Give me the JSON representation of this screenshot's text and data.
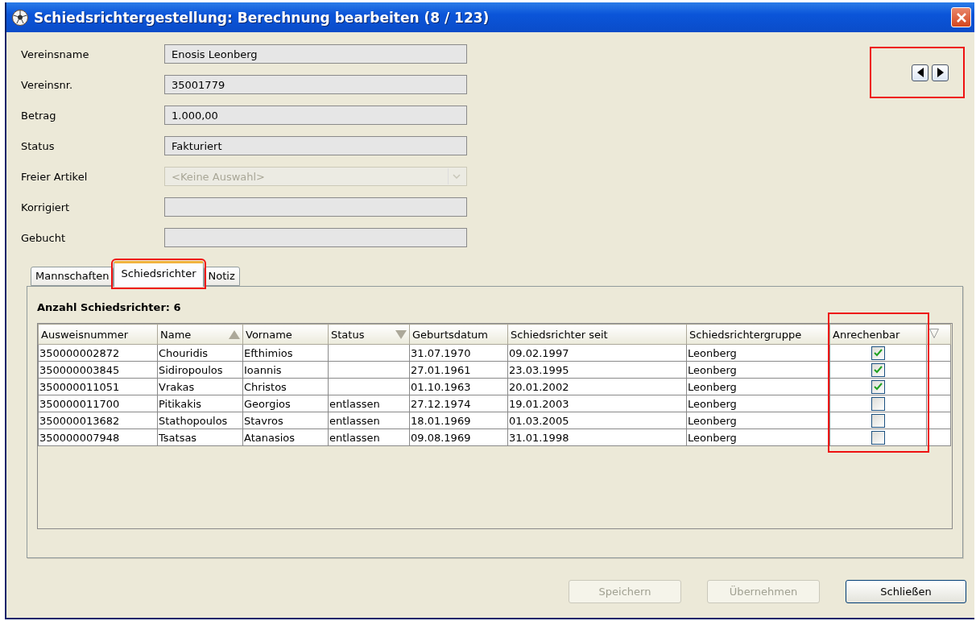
{
  "window": {
    "title": "Schiedsrichtergestellung: Berechnung bearbeiten (8 / 123)"
  },
  "nav": {
    "highlighted": true
  },
  "fields": [
    {
      "label": "Vereinsname",
      "kind": "text",
      "value": "Enosis Leonberg"
    },
    {
      "label": "Vereinsnr.",
      "kind": "text",
      "value": "35001779"
    },
    {
      "label": "Betrag",
      "kind": "text",
      "value": "1.000,00"
    },
    {
      "label": "Status",
      "kind": "text",
      "value": "Fakturiert"
    },
    {
      "label": "Freier Artikel",
      "kind": "select",
      "placeholder": "<Keine Auswahl>",
      "disabled": true
    },
    {
      "label": "Korrigiert",
      "kind": "text"
    },
    {
      "label": "Gebucht",
      "kind": "text"
    }
  ],
  "tabs": [
    {
      "label": "Mannschaften",
      "selected": false,
      "highlighted": false
    },
    {
      "label": "Schiedsrichter",
      "selected": true,
      "highlighted": true
    },
    {
      "label": "Notiz",
      "selected": false,
      "highlighted": false
    }
  ],
  "count_label": "Anzahl Schiedsrichter: 6",
  "table": {
    "columns": [
      {
        "label": "Ausweisnummer",
        "sorted": false,
        "highlighted": false
      },
      {
        "label": "Name",
        "sorted": true,
        "ascending": true,
        "highlighted": false
      },
      {
        "label": "Vorname",
        "sorted": false,
        "highlighted": false
      },
      {
        "label": "Status",
        "sorted": true,
        "ascending": false,
        "highlighted": false
      },
      {
        "label": "Geburtsdatum",
        "sorted": false,
        "highlighted": false
      },
      {
        "label": "Schiedsrichter seit",
        "sorted": false,
        "highlighted": false
      },
      {
        "label": "Schiedsrichtergruppe",
        "sorted": false,
        "highlighted": false
      },
      {
        "label": "Anrechenbar",
        "sorted": false,
        "highlighted": true
      }
    ],
    "rows": [
      {
        "cells": [
          "350000002872",
          "Chouridis",
          "Efthimios",
          "",
          "31.07.1970",
          "09.02.1997",
          "Leonberg"
        ],
        "checked": true
      },
      {
        "cells": [
          "350000003845",
          "Sidiropoulos",
          "Ioannis",
          "",
          "27.01.1961",
          "23.03.1995",
          "Leonberg"
        ],
        "checked": true
      },
      {
        "cells": [
          "350000011051",
          "Vrakas",
          "Christos",
          "",
          "01.10.1963",
          "20.01.2002",
          "Leonberg"
        ],
        "checked": true
      },
      {
        "cells": [
          "350000011700",
          "Pitikakis",
          "Georgios",
          "entlassen",
          "27.12.1974",
          "19.01.2003",
          "Leonberg"
        ],
        "checked": false
      },
      {
        "cells": [
          "350000013682",
          "Stathopoulos",
          "Stavros",
          "entlassen",
          "18.01.1969",
          "01.03.2005",
          "Leonberg"
        ],
        "checked": false
      },
      {
        "cells": [
          "350000007948",
          "Tsatsas",
          "Atanasios",
          "entlassen",
          "09.08.1969",
          "31.01.1998",
          "Leonberg"
        ],
        "checked": false
      }
    ]
  },
  "buttons": [
    {
      "label": "Speichern",
      "disabled": true
    },
    {
      "label": "Übernehmen",
      "disabled": true
    },
    {
      "label": "Schließen",
      "disabled": false
    }
  ]
}
